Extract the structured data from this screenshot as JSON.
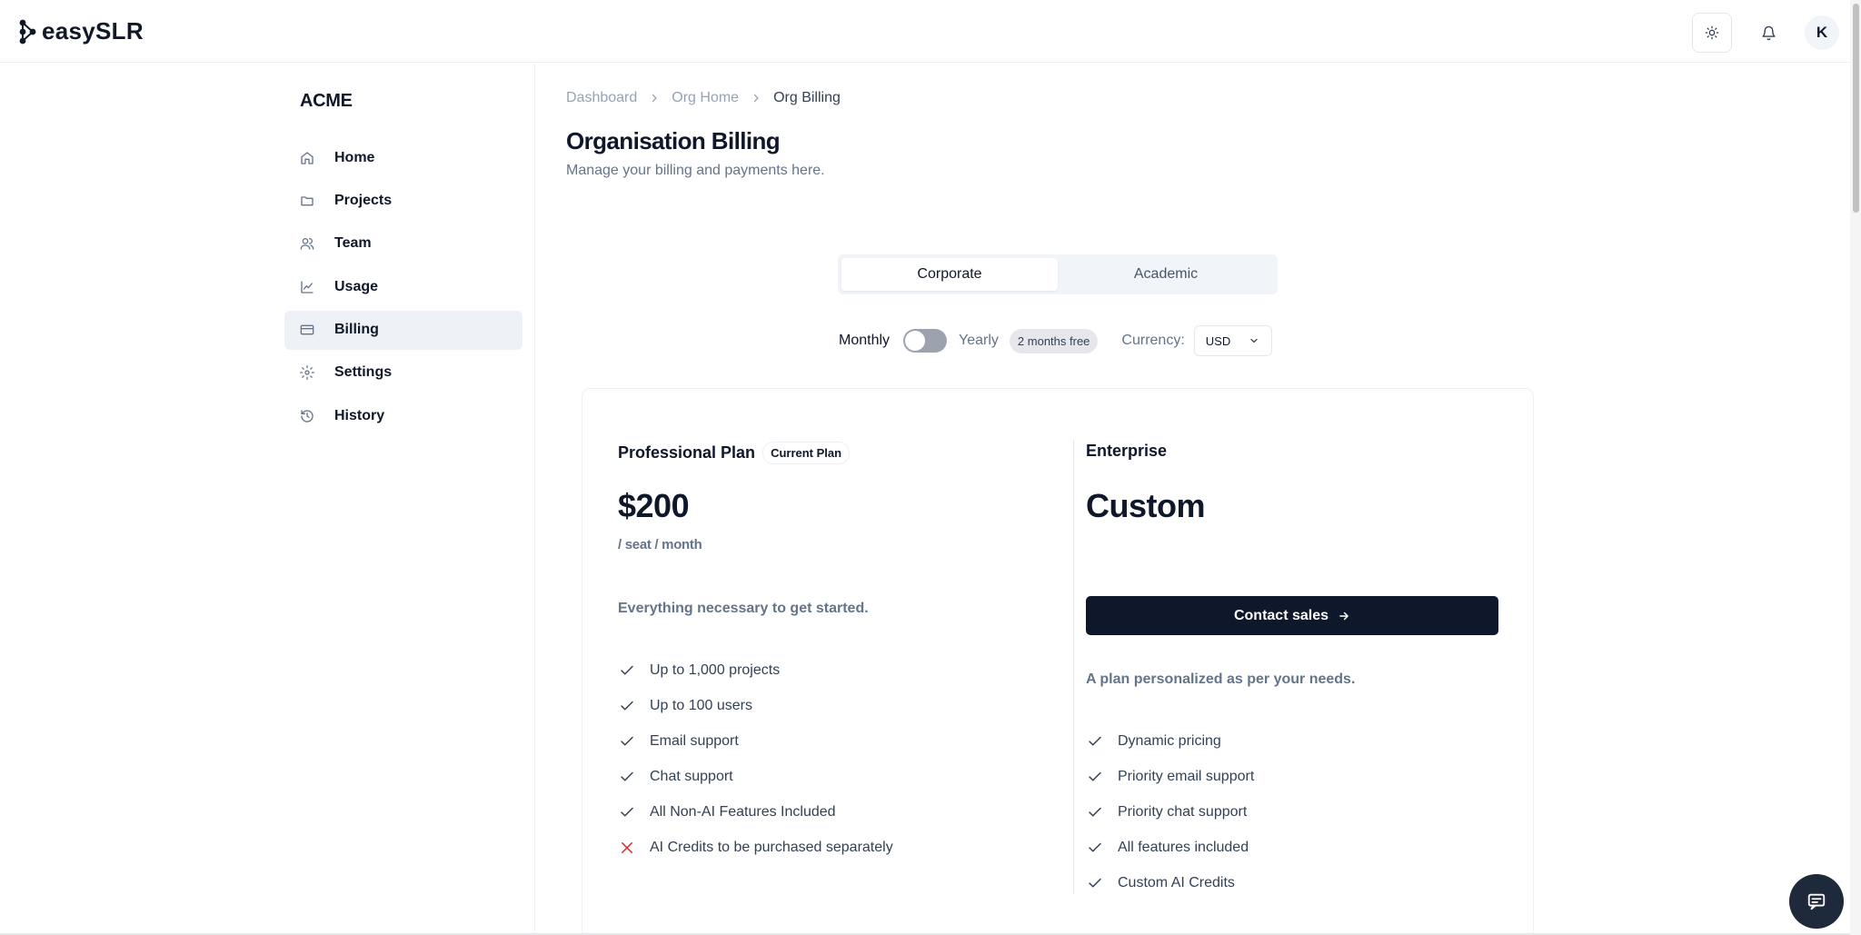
{
  "app": {
    "logo_text": "easySLR",
    "avatar_initial": "K"
  },
  "sidebar": {
    "org_name": "ACME",
    "items": [
      {
        "label": "Home",
        "icon": "home-icon",
        "active": false
      },
      {
        "label": "Projects",
        "icon": "folder-icon",
        "active": false
      },
      {
        "label": "Team",
        "icon": "users-icon",
        "active": false
      },
      {
        "label": "Usage",
        "icon": "chart-icon",
        "active": false
      },
      {
        "label": "Billing",
        "icon": "credit-card-icon",
        "active": true
      },
      {
        "label": "Settings",
        "icon": "gear-icon",
        "active": false
      },
      {
        "label": "History",
        "icon": "history-icon",
        "active": false
      }
    ]
  },
  "breadcrumb": [
    "Dashboard",
    "Org Home",
    "Org Billing"
  ],
  "page": {
    "title": "Organisation Billing",
    "subtitle": "Manage your billing and payments here."
  },
  "tabs": [
    {
      "label": "Corporate",
      "active": true
    },
    {
      "label": "Academic",
      "active": false
    }
  ],
  "billing_cycle": {
    "monthly_label": "Monthly",
    "yearly_label": "Yearly",
    "yearly_selected": false,
    "badge": "2 months free",
    "currency_label": "Currency:",
    "currency_value": "USD"
  },
  "plans": {
    "professional": {
      "name": "Professional Plan",
      "badge": "Current Plan",
      "price": "$200",
      "unit": "/ seat / month",
      "description": "Everything necessary to get started.",
      "features": [
        {
          "text": "Up to 1,000 projects",
          "included": true
        },
        {
          "text": "Up to 100 users",
          "included": true
        },
        {
          "text": "Email support",
          "included": true
        },
        {
          "text": "Chat support",
          "included": true
        },
        {
          "text": "All Non-AI Features Included",
          "included": true
        },
        {
          "text": "AI Credits to be purchased separately",
          "included": false
        }
      ]
    },
    "enterprise": {
      "name": "Enterprise",
      "price": "Custom",
      "cta": "Contact sales",
      "description": "A plan personalized as per your needs.",
      "features": [
        {
          "text": "Dynamic pricing",
          "included": true
        },
        {
          "text": "Priority email support",
          "included": true
        },
        {
          "text": "Priority chat support",
          "included": true
        },
        {
          "text": "All features included",
          "included": true
        },
        {
          "text": "Custom AI Credits",
          "included": true
        }
      ]
    }
  },
  "colors": {
    "primary": "#0f172a",
    "muted": "#64748b",
    "active_nav_bg": "#eef2f6",
    "check": "#334155",
    "cross": "#dc2626"
  }
}
